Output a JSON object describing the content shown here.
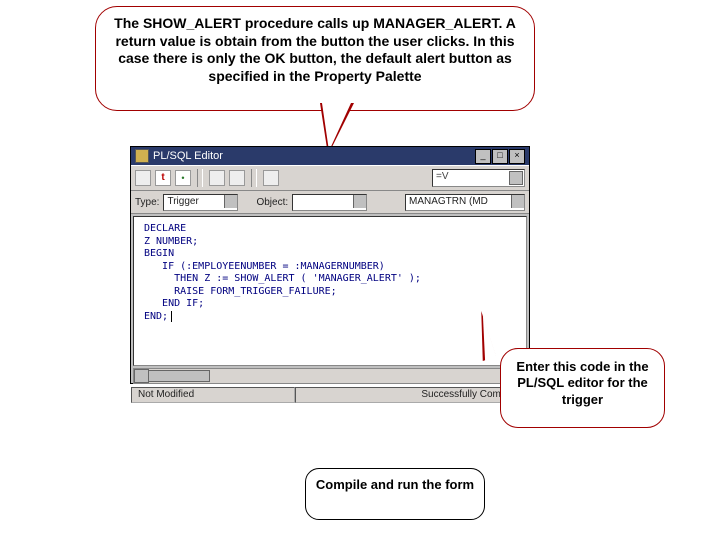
{
  "top_callout": "The SHOW_ALERT procedure calls up MANAGER_ALERT. A return value is obtain from the button the user clicks. In this case there is only the OK button, the default alert button as specified in the Property Palette",
  "right_callout": "Enter this code in the PL/SQL editor for the trigger",
  "bottom_callout": "Compile and run the form",
  "editor": {
    "title": "PL/SQL Editor",
    "window_controls": {
      "min": "_",
      "max": "□",
      "close": "×"
    },
    "toolbar_combo": "=V",
    "row2": {
      "type_label": "Type:",
      "type_value": "Trigger",
      "object_label": "Object:",
      "object_value": "",
      "object_value2": "MANAGTRN (MD"
    },
    "code_lines": [
      "DECLARE",
      "Z NUMBER;",
      "BEGIN",
      "   IF (:EMPLOYEENUMBER = :MANAGERNUMBER)",
      "     THEN Z := SHOW_ALERT ( 'MANAGER_ALERT' );",
      "     RAISE FORM_TRIGGER_FAILURE;",
      "   END IF;",
      "END;"
    ],
    "status_left": "Not Modified",
    "status_right": "Successfully Compiled"
  }
}
